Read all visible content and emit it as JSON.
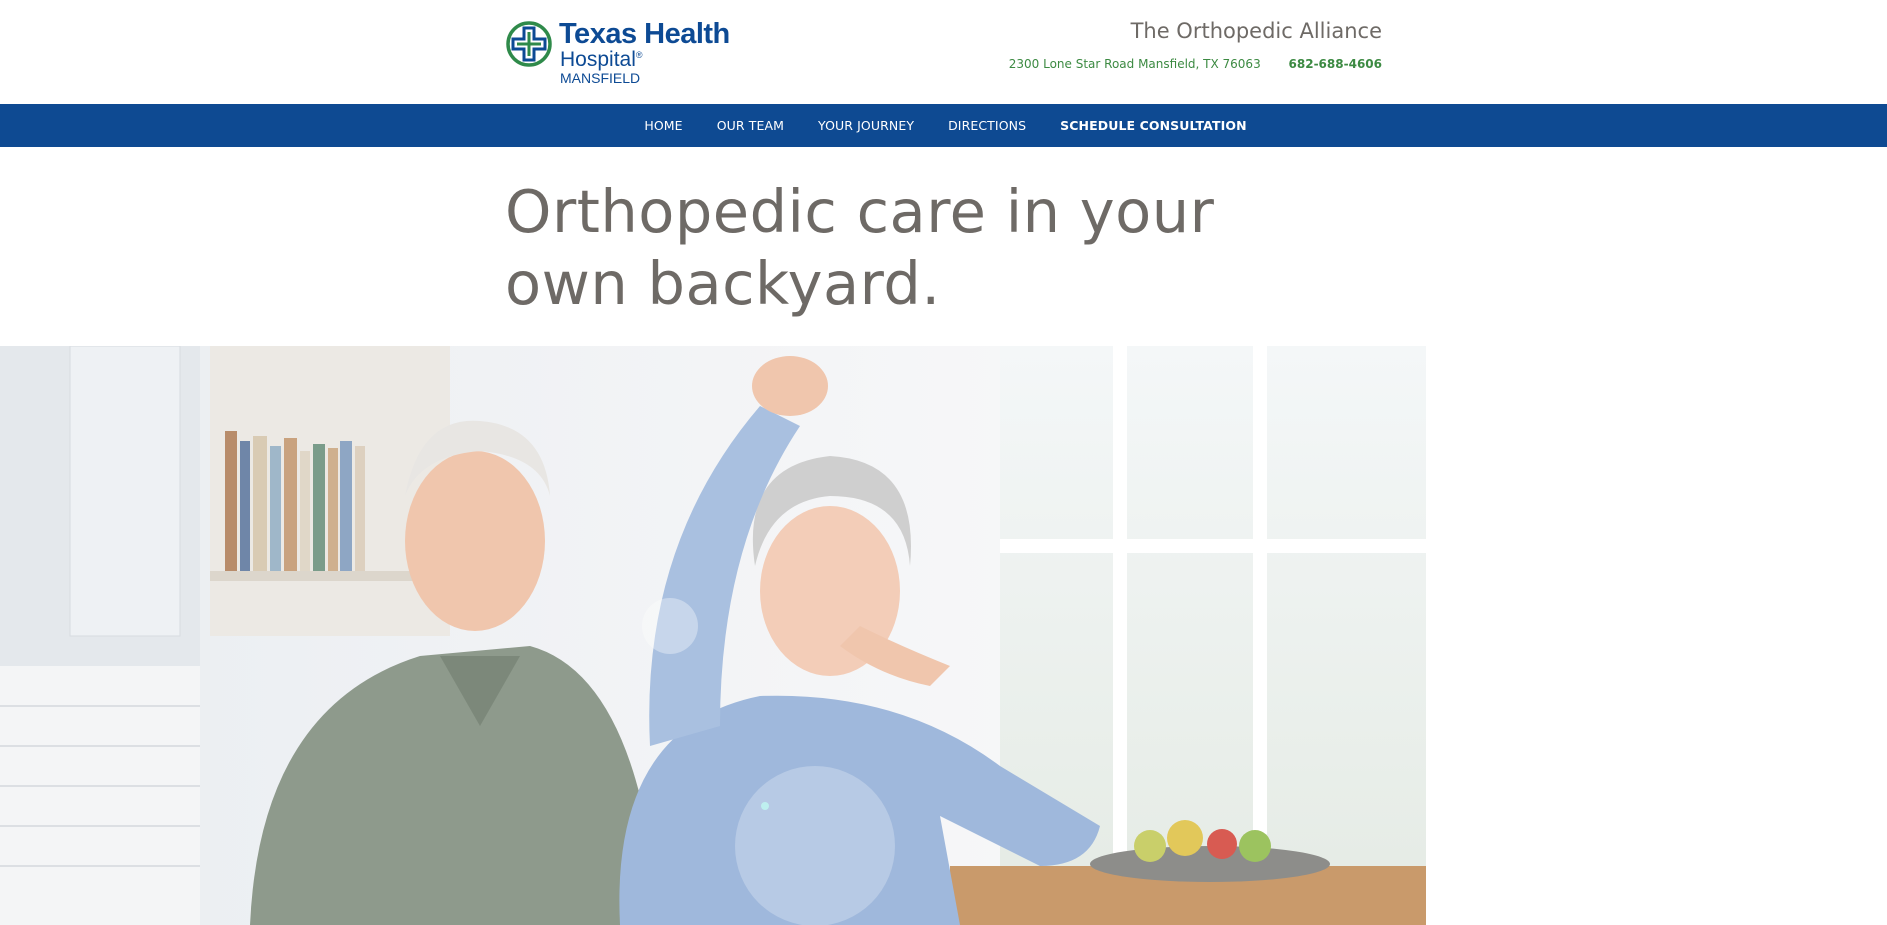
{
  "header": {
    "logo": {
      "line1": "Texas Health",
      "line2": "Hospital",
      "registered": "®",
      "line3": "MANSFIELD",
      "icon": "cross-logo-icon"
    },
    "title": "The Orthopedic Alliance",
    "address": "2300 Lone Star Road Mansfield, TX 76063",
    "phone": "682-688-4606"
  },
  "nav": {
    "items": [
      {
        "label": "HOME"
      },
      {
        "label": "OUR TEAM"
      },
      {
        "label": "YOUR JOURNEY"
      },
      {
        "label": "DIRECTIONS"
      },
      {
        "label": "SCHEDULE CONSULTATION"
      }
    ]
  },
  "hero": {
    "headline_line1": "Orthopedic care in your",
    "headline_line2": "own backyard.",
    "image": "photo-senior-couple-dancing-in-kitchen"
  },
  "colors": {
    "nav_bg": "#0e4a92",
    "brand_blue": "#0d4a94",
    "brand_green": "#3c8a42",
    "heading_gray": "#6e6a66"
  }
}
